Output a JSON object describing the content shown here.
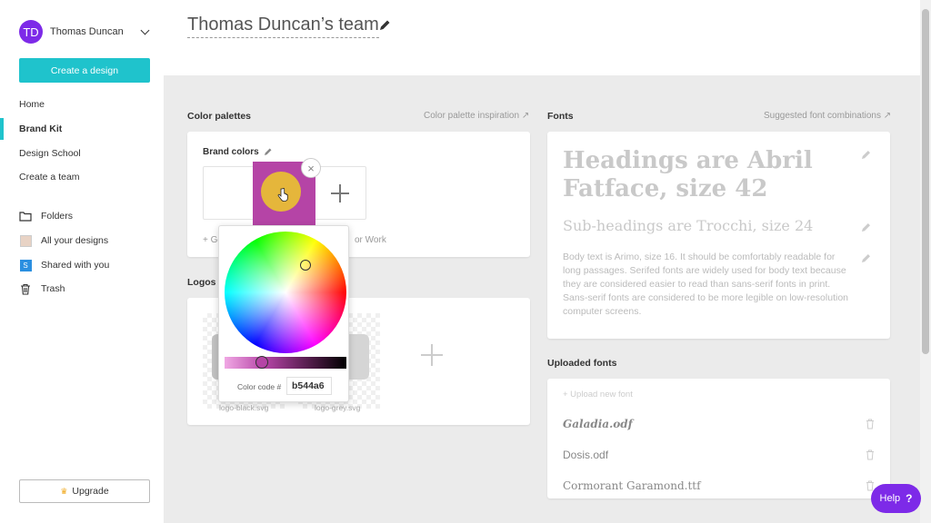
{
  "user": {
    "initials": "TD",
    "name": "Thomas Duncan"
  },
  "sidebar": {
    "create_label": "Create a design",
    "nav": [
      "Home",
      "Brand Kit",
      "Design School",
      "Create a team"
    ],
    "links": [
      "Folders",
      "All your designs",
      "Shared with you",
      "Trash"
    ],
    "shared_icon_letter": "S",
    "upgrade_label": "Upgrade"
  },
  "header": {
    "team_title": "Thomas Duncan’s team"
  },
  "palettes": {
    "title": "Color palettes",
    "inspiration_link": "Color palette inspiration ↗",
    "brand_label": "Brand colors",
    "generate_text": "+ Ge",
    "generate_text_tail": "or Work",
    "swatch_color": "#b544a6"
  },
  "logos": {
    "title": "Logos",
    "captions": [
      "logo-black.svg",
      "logo-grey.svg"
    ]
  },
  "fonts": {
    "title": "Fonts",
    "suggest_link": "Suggested font combinations ↗",
    "heading_sample": "Headings are Abril Fatface, size 42",
    "subheading_sample": "Sub-headings are Trocchi, size 24",
    "body_sample": "Body text is Arimo, size 16. It should be comfortably readable for long passages. Serifed fonts are widely used for body text because they are considered easier to read than sans-serif fonts in print. Sans-serif fonts are considered to be more legible on low-resolution computer screens."
  },
  "uploaded_fonts": {
    "title": "Uploaded fonts",
    "upload_link": "+ Upload new font",
    "files": [
      "Galadia.odf",
      "Dosis.odf",
      "Cormorant Garamond.ttf"
    ]
  },
  "color_picker": {
    "code_label": "Color code #",
    "code_value": "b544a6",
    "close_symbol": "×"
  },
  "help": {
    "label": "Help",
    "symbol": "?"
  },
  "colors": {
    "accent": "#1fc3cc",
    "brand_purple": "#7d2ae8",
    "swatch": "#b544a6",
    "swatch_circle": "#e5b63b"
  }
}
